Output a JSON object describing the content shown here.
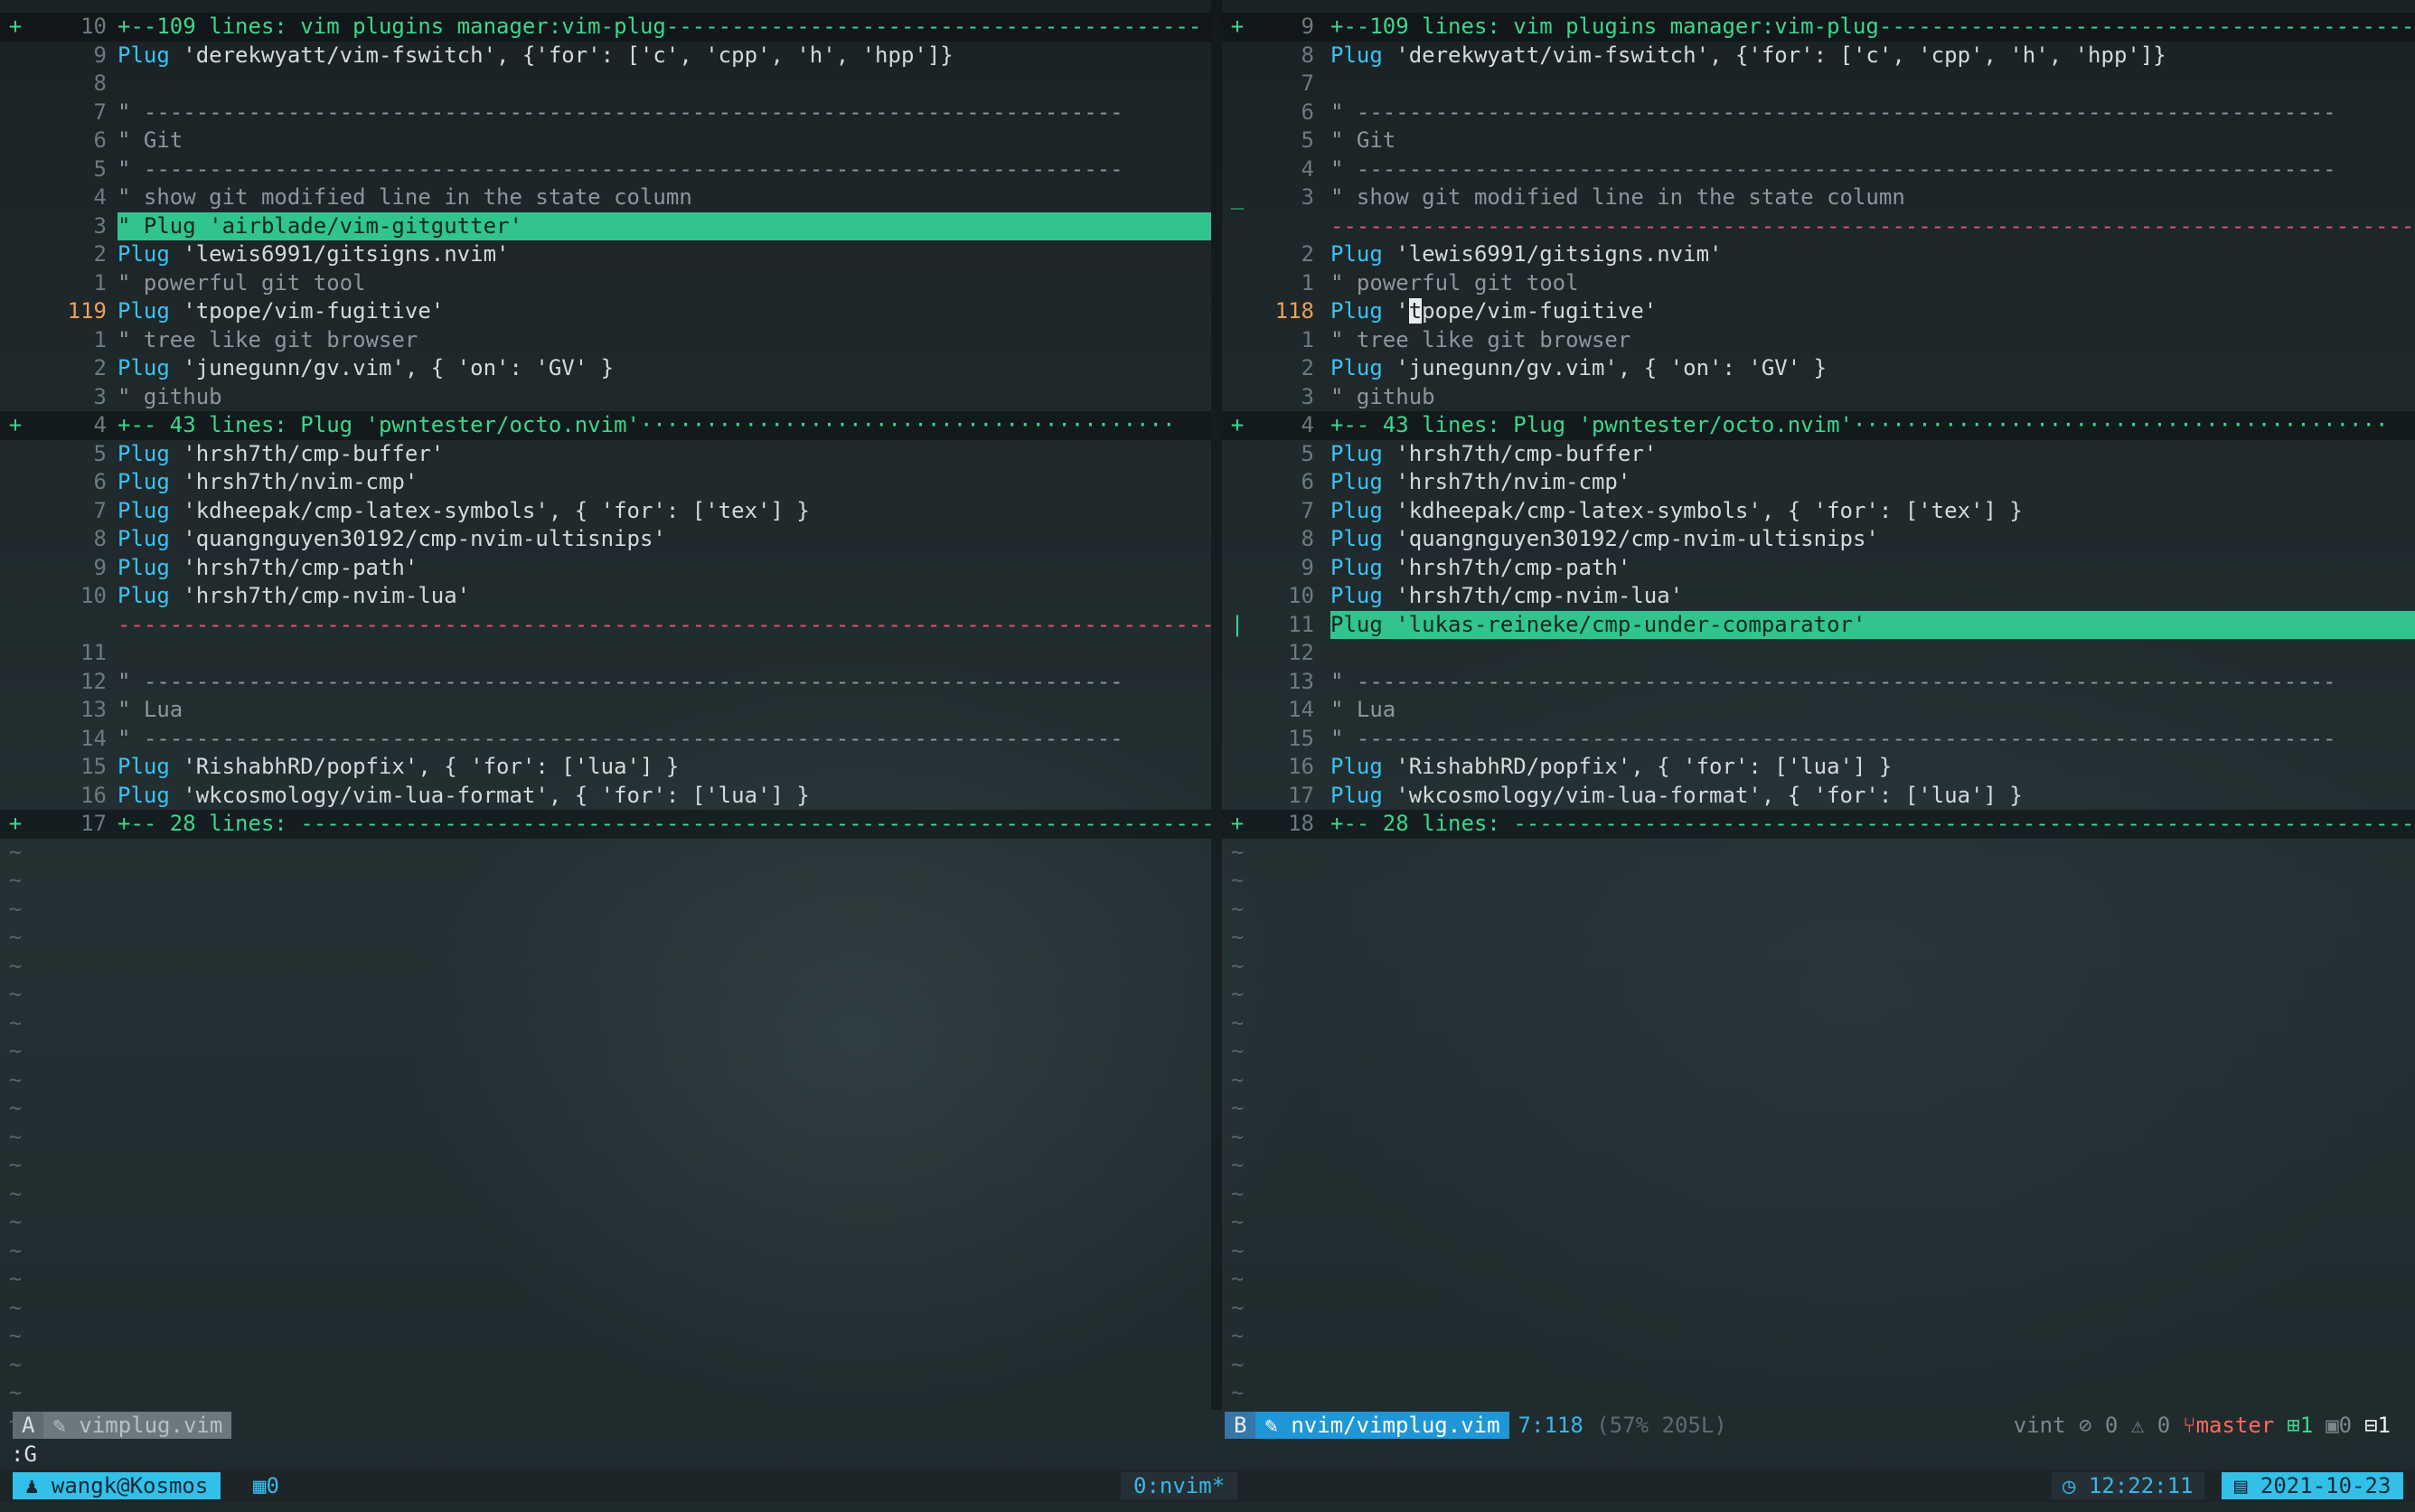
{
  "left_pane": {
    "lines": [
      {
        "sign": "+",
        "num": "10",
        "type": "fold",
        "text": "+--109 lines: vim plugins manager:vim-plug-----------------------------------------"
      },
      {
        "sign": "",
        "num": "9",
        "type": "plug",
        "kw": "Plug",
        "text": " 'derekwyatt/vim-fswitch', {'for': ['c', 'cpp', 'h', 'hpp']}"
      },
      {
        "sign": "",
        "num": "8",
        "type": "blank",
        "text": ""
      },
      {
        "sign": "",
        "num": "7",
        "type": "comment",
        "text": "\" ---------------------------------------------------------------------------"
      },
      {
        "sign": "",
        "num": "6",
        "type": "comment",
        "text": "\" Git"
      },
      {
        "sign": "",
        "num": "5",
        "type": "comment",
        "text": "\" ---------------------------------------------------------------------------"
      },
      {
        "sign": "",
        "num": "4",
        "type": "comment",
        "text": "\" show git modified line in the state column"
      },
      {
        "sign": "",
        "num": "3",
        "type": "hl",
        "text": "\" Plug 'airblade/vim-gitgutter'"
      },
      {
        "sign": "",
        "num": "2",
        "type": "plug",
        "kw": "Plug",
        "text": " 'lewis6991/gitsigns.nvim'"
      },
      {
        "sign": "",
        "num": "1",
        "type": "comment",
        "text": "\" powerful git tool"
      },
      {
        "sign": "",
        "num": "119",
        "cur": true,
        "type": "plug",
        "kw": "Plug",
        "text": " 'tpope/vim-fugitive'"
      },
      {
        "sign": "",
        "num": "1",
        "type": "comment",
        "text": "\" tree like git browser"
      },
      {
        "sign": "",
        "num": "2",
        "type": "plug",
        "kw": "Plug",
        "text": " 'junegunn/gv.vim', { 'on': 'GV' }"
      },
      {
        "sign": "",
        "num": "3",
        "type": "comment",
        "text": "\" github"
      },
      {
        "sign": "+",
        "num": "4",
        "type": "fold",
        "text": "+-- 43 lines: Plug 'pwntester/octo.nvim'·········································"
      },
      {
        "sign": "",
        "num": "5",
        "type": "plug",
        "kw": "Plug",
        "text": " 'hrsh7th/cmp-buffer'"
      },
      {
        "sign": "",
        "num": "6",
        "type": "plug",
        "kw": "Plug",
        "text": " 'hrsh7th/nvim-cmp'"
      },
      {
        "sign": "",
        "num": "7",
        "type": "plug",
        "kw": "Plug",
        "text": " 'kdheepak/cmp-latex-symbols', { 'for': ['tex'] }"
      },
      {
        "sign": "",
        "num": "8",
        "type": "plug",
        "kw": "Plug",
        "text": " 'quangnguyen30192/cmp-nvim-ultisnips'"
      },
      {
        "sign": "",
        "num": "9",
        "type": "plug",
        "kw": "Plug",
        "text": " 'hrsh7th/cmp-path'"
      },
      {
        "sign": "",
        "num": "10",
        "type": "plug",
        "kw": "Plug",
        "text": " 'hrsh7th/cmp-nvim-lua'"
      },
      {
        "sign": "",
        "num": "",
        "type": "del",
        "text": "-------------------------------------------------------------------------------------"
      },
      {
        "sign": "",
        "num": "11",
        "type": "blank",
        "text": ""
      },
      {
        "sign": "",
        "num": "12",
        "type": "comment",
        "text": "\" ---------------------------------------------------------------------------"
      },
      {
        "sign": "",
        "num": "13",
        "type": "comment",
        "text": "\" Lua"
      },
      {
        "sign": "",
        "num": "14",
        "type": "comment",
        "text": "\" ---------------------------------------------------------------------------"
      },
      {
        "sign": "",
        "num": "15",
        "type": "plug",
        "kw": "Plug",
        "text": " 'RishabhRD/popfix', { 'for': ['lua'] }"
      },
      {
        "sign": "",
        "num": "16",
        "type": "plug",
        "kw": "Plug",
        "text": " 'wkcosmology/vim-lua-format', { 'for': ['lua'] }"
      },
      {
        "sign": "+",
        "num": "17",
        "type": "fold",
        "text": "+-- 28 lines: ----------------------------------------------------------------------"
      }
    ],
    "tildes": 21
  },
  "right_pane": {
    "lines": [
      {
        "sign": "+",
        "num": "9",
        "type": "fold",
        "text": "+--109 lines: vim plugins manager:vim-plug-----------------------------------------"
      },
      {
        "sign": "",
        "num": "8",
        "type": "plug",
        "kw": "Plug",
        "text": " 'derekwyatt/vim-fswitch', {'for': ['c', 'cpp', 'h', 'hpp']}"
      },
      {
        "sign": "",
        "num": "7",
        "type": "blank",
        "text": ""
      },
      {
        "sign": "",
        "num": "6",
        "type": "comment",
        "text": "\" ---------------------------------------------------------------------------"
      },
      {
        "sign": "",
        "num": "5",
        "type": "comment",
        "text": "\" Git"
      },
      {
        "sign": "",
        "num": "4",
        "type": "comment",
        "text": "\" ---------------------------------------------------------------------------"
      },
      {
        "sign": "_",
        "num": "3",
        "type": "comment",
        "text": "\" show git modified line in the state column"
      },
      {
        "sign": "",
        "num": "",
        "type": "del",
        "text": "-------------------------------------------------------------------------------------"
      },
      {
        "sign": "",
        "num": "2",
        "type": "plug",
        "kw": "Plug",
        "text": " 'lewis6991/gitsigns.nvim'"
      },
      {
        "sign": "",
        "num": "1",
        "type": "comment",
        "text": "\" powerful git tool"
      },
      {
        "sign": "",
        "num": "118",
        "cur": true,
        "type": "cursorplug",
        "kw": "Plug",
        "pre": " '",
        "cursor": "t",
        "text": "pope/vim-fugitive'"
      },
      {
        "sign": "",
        "num": "1",
        "type": "comment",
        "text": "\" tree like git browser"
      },
      {
        "sign": "",
        "num": "2",
        "type": "plug",
        "kw": "Plug",
        "text": " 'junegunn/gv.vim', { 'on': 'GV' }"
      },
      {
        "sign": "",
        "num": "3",
        "type": "comment",
        "text": "\" github"
      },
      {
        "sign": "+",
        "num": "4",
        "type": "fold",
        "text": "+-- 43 lines: Plug 'pwntester/octo.nvim'·········································"
      },
      {
        "sign": "",
        "num": "5",
        "type": "plug",
        "kw": "Plug",
        "text": " 'hrsh7th/cmp-buffer'"
      },
      {
        "sign": "",
        "num": "6",
        "type": "plug",
        "kw": "Plug",
        "text": " 'hrsh7th/nvim-cmp'"
      },
      {
        "sign": "",
        "num": "7",
        "type": "plug",
        "kw": "Plug",
        "text": " 'kdheepak/cmp-latex-symbols', { 'for': ['tex'] }"
      },
      {
        "sign": "",
        "num": "8",
        "type": "plug",
        "kw": "Plug",
        "text": " 'quangnguyen30192/cmp-nvim-ultisnips'"
      },
      {
        "sign": "",
        "num": "9",
        "type": "plug",
        "kw": "Plug",
        "text": " 'hrsh7th/cmp-path'"
      },
      {
        "sign": "",
        "num": "10",
        "type": "plug",
        "kw": "Plug",
        "text": " 'hrsh7th/cmp-nvim-lua'"
      },
      {
        "sign": "|",
        "num": "11",
        "type": "hl",
        "text": "Plug 'lukas-reineke/cmp-under-comparator'"
      },
      {
        "sign": "",
        "num": "12",
        "type": "blank",
        "text": ""
      },
      {
        "sign": "",
        "num": "13",
        "type": "comment",
        "text": "\" ---------------------------------------------------------------------------"
      },
      {
        "sign": "",
        "num": "14",
        "type": "comment",
        "text": "\" Lua"
      },
      {
        "sign": "",
        "num": "15",
        "type": "comment",
        "text": "\" ---------------------------------------------------------------------------"
      },
      {
        "sign": "",
        "num": "16",
        "type": "plug",
        "kw": "Plug",
        "text": " 'RishabhRD/popfix', { 'for': ['lua'] }"
      },
      {
        "sign": "",
        "num": "17",
        "type": "plug",
        "kw": "Plug",
        "text": " 'wkcosmology/vim-lua-format', { 'for': ['lua'] }"
      },
      {
        "sign": "+",
        "num": "18",
        "type": "fold",
        "text": "+-- 28 lines: ----------------------------------------------------------------------"
      }
    ],
    "tildes": 21
  },
  "statusline_left": {
    "mode": "A",
    "file": "vimplug.vim",
    "file_icon": "pencil-icon"
  },
  "statusline_right": {
    "mode": "B",
    "file": "nvim/vimplug.vim",
    "file_icon": "pencil-icon",
    "position": "7:118",
    "percent": "(57% 205L)",
    "lint_name": "vint",
    "errors": "0",
    "warnings": "0",
    "branch": "master",
    "added": "1",
    "modified": "0",
    "removed": "1"
  },
  "cmdline": ":G",
  "tmux": {
    "user": "wangk@Kosmos",
    "session": "0",
    "window": "0:nvim*",
    "time": "12:22:11",
    "date": "2021-10-23"
  },
  "colors": {
    "accent": "#32c48e",
    "keyword": "#3cc2f0",
    "delete": "#e0566c",
    "tmux": "#33c0e8"
  }
}
